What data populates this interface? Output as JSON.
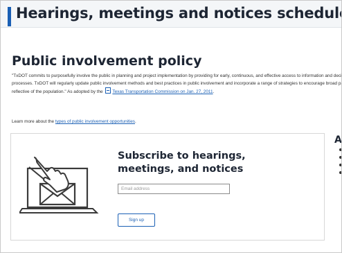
{
  "header": {
    "title": "Hearings, meetings and notices schedule"
  },
  "policy": {
    "heading": "Public involvement policy",
    "text_before_link": "\"TxDOT commits to purposefully involve the public in planning and project implementation by providing for early, continuous, and effective access to information and decision-making processes. TxDOT will regularly update public involvement methods and best practices in public involvement and incorporate a range of strategies to encourage broad participation reflective of the population.\" As adopted by the",
    "commission_link": "Texas Transportation Commission on Jan. 27, 2011",
    "text_after_link": ".",
    "learn_prefix": "Learn more about the",
    "learn_link": "types of public involvement opportunities",
    "learn_suffix": "."
  },
  "subscribe": {
    "heading": "Subscribe to hearings, meetings, and notices",
    "email_placeholder": "Email address",
    "email_value": "",
    "signup_label": "Sign up"
  },
  "aside": {
    "heading": "A",
    "bullet_count": 4
  },
  "colors": {
    "accent": "#1a5fb4",
    "heading_text": "#1d2533",
    "header_bg": "#f4f6f8"
  },
  "icons": [
    "document-icon",
    "envelope-laptop-illustration",
    "hand-pointer-icon"
  ]
}
